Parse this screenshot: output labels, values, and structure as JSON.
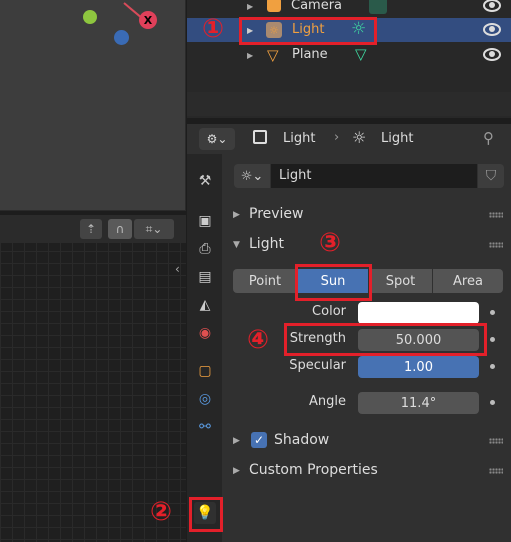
{
  "outliner": {
    "items": [
      {
        "name": "Camera"
      },
      {
        "name": "Light",
        "selected": true
      },
      {
        "name": "Plane"
      }
    ]
  },
  "props_header": {
    "object_label": "Light",
    "data_label": "Light"
  },
  "light_datablock": {
    "name": "Light"
  },
  "panels": {
    "preview": "Preview",
    "light": "Light",
    "shadow": "Shadow",
    "custom_properties": "Custom Properties"
  },
  "light_types": [
    "Point",
    "Sun",
    "Spot",
    "Area"
  ],
  "light_type_selected": "Sun",
  "fields": {
    "color_label": "Color",
    "strength_label": "Strength",
    "strength_value": "50.000",
    "specular_label": "Specular",
    "specular_value": "1.00",
    "angle_label": "Angle",
    "angle_value": "11.4°"
  },
  "shadow_enabled": true,
  "annotations": {
    "n1": "①",
    "n2": "②",
    "n3": "③",
    "n4": "④"
  },
  "colors": {
    "accent": "#4772b3",
    "selected_row": "#334d80",
    "annotation": "#e3202a",
    "light_name": "#f0a040"
  }
}
